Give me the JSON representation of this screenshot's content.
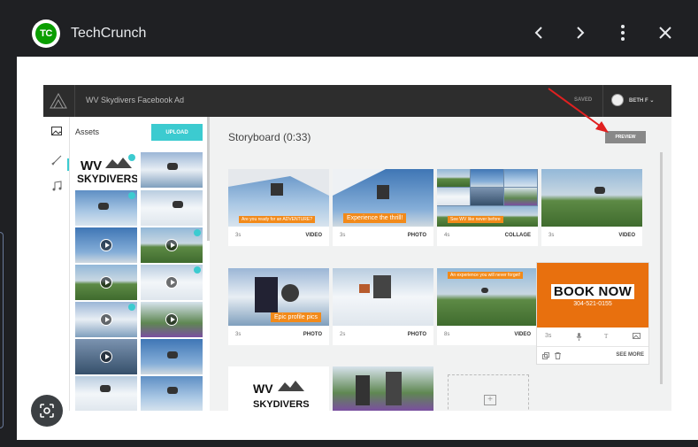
{
  "viewer": {
    "site_name": "TechCrunch",
    "logo_text": "TC",
    "icons": [
      "back-icon",
      "forward-icon",
      "more-icon",
      "close-icon"
    ]
  },
  "app": {
    "title": "WV Skydivers Facebook Ad",
    "saved_label": "SAVED",
    "user_label": "BETH F",
    "sidebar": {
      "assets_label": "Assets",
      "upload_label": "UPLOAD",
      "icons": [
        "image-icon",
        "brush-icon",
        "music-icon"
      ],
      "logo_text": "WV SKYDIVERS"
    },
    "storyboard_title": "Storyboard (0:33)",
    "preview_label": "PREVIEW",
    "tiles": [
      {
        "duration": "3s",
        "type": "VIDEO",
        "caption": "Are you ready for an ADVENTURE?"
      },
      {
        "duration": "3s",
        "type": "PHOTO",
        "caption": "Experience the thrill!"
      },
      {
        "duration": "4s",
        "type": "COLLAGE",
        "caption": "See WV like never before"
      },
      {
        "duration": "3s",
        "type": "VIDEO",
        "caption": ""
      },
      {
        "duration": "3s",
        "type": "PHOTO",
        "caption": "Epic profile pics"
      },
      {
        "duration": "2s",
        "type": "PHOTO",
        "caption": ""
      },
      {
        "duration": "8s",
        "type": "VIDEO",
        "caption": "An experience you will never forget!"
      }
    ],
    "book_card": {
      "headline": "BOOK NOW",
      "phone": "304-521-0155",
      "duration": "3s",
      "see_more": "SEE MORE"
    },
    "bottom_logo_text": "WV SKYDIVERS"
  },
  "colors": {
    "accent": "#3ccbd0",
    "orange": "#e8700e",
    "annotation_arrow": "#e02020"
  }
}
